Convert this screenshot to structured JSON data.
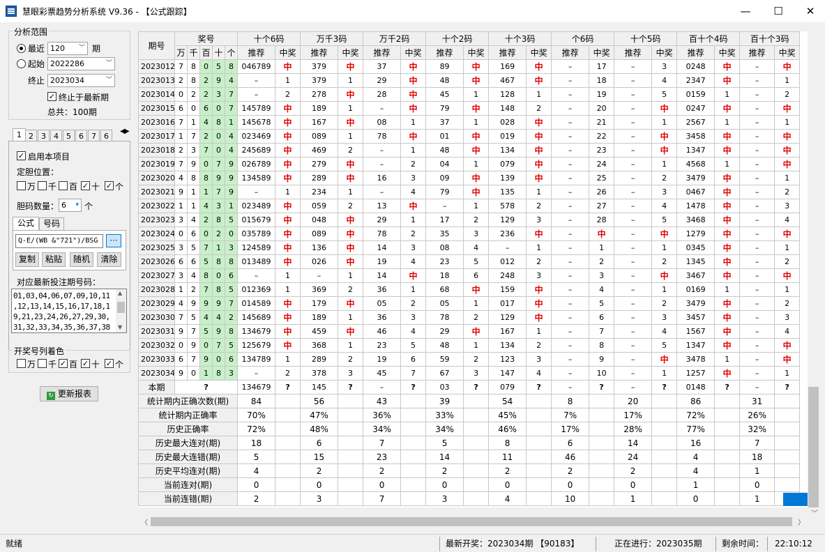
{
  "window": {
    "title": "慧眼彩票趋势分析系统 V9.36 - 【公式跟踪】",
    "minimize": "—",
    "maximize": "☐",
    "close": "✕"
  },
  "left": {
    "range_title": "分析范围",
    "recent_label": "最近",
    "recent_value": "120",
    "period_suffix": "期",
    "start_label": "起始",
    "start_value": "2022286",
    "end_label": "终止",
    "end_value": "2023034",
    "end_latest_label": "终止于最新期",
    "total_label": "总共：100期",
    "tabs": [
      "1",
      "2",
      "3",
      "4",
      "5",
      "6",
      "7",
      "6"
    ],
    "enable_label": "启用本项目",
    "pos_label": "定胆位置：",
    "positions": [
      {
        "label": "万",
        "checked": false
      },
      {
        "label": "千",
        "checked": false
      },
      {
        "label": "百",
        "checked": false
      },
      {
        "label": "十",
        "checked": true
      },
      {
        "label": "个",
        "checked": true
      }
    ],
    "count_label": "胆码数量：",
    "count_value": "6",
    "count_unit": "个",
    "sub_tabs": [
      "公式",
      "号码"
    ],
    "formula": "Q-E/(WB &\"721\")/BSG",
    "formula_btn": "···",
    "buttons": [
      "复制",
      "粘贴",
      "随机",
      "清除"
    ],
    "numbers_label": "对应最新投注期号码：",
    "numbers_lines": [
      "01,03,04,06,07,09,10,11",
      ",12,13,14,15,16,17,18,1",
      "9,21,23,24,26,27,29,30,",
      "31,32,33,34,35,36,37,38"
    ],
    "color_title": "开奖号列着色",
    "color_positions": [
      {
        "label": "万",
        "checked": false
      },
      {
        "label": "千",
        "checked": false
      },
      {
        "label": "百",
        "checked": true
      },
      {
        "label": "十",
        "checked": true
      },
      {
        "label": "个",
        "checked": true
      }
    ],
    "update_btn": "更新报表"
  },
  "table": {
    "period_header": "期号",
    "draw_header": "奖号",
    "digit_headers": [
      "万",
      "千",
      "百",
      "十",
      "个"
    ],
    "groups": [
      "十个6码",
      "万千3码",
      "万千2码",
      "十个2码",
      "十个3码",
      "个6码",
      "十个5码",
      "百十个4码",
      "百十个3码"
    ],
    "sub_headers": [
      "推荐",
      "中奖"
    ],
    "rows": [
      {
        "p": "2023012",
        "d": [
          "7",
          "8",
          "0",
          "5",
          "8"
        ],
        "c": [
          "046789",
          "中",
          "379",
          "中",
          "37",
          "中",
          "89",
          "中",
          "169",
          "中",
          "–",
          "17",
          "–",
          "3",
          "0248",
          "中",
          "–",
          "中"
        ]
      },
      {
        "p": "2023013",
        "d": [
          "2",
          "8",
          "2",
          "9",
          "4"
        ],
        "c": [
          "–",
          "1",
          "379",
          "1",
          "29",
          "中",
          "48",
          "中",
          "467",
          "中",
          "–",
          "18",
          "–",
          "4",
          "2347",
          "中",
          "–",
          "1"
        ]
      },
      {
        "p": "2023014",
        "d": [
          "0",
          "2",
          "2",
          "3",
          "7"
        ],
        "c": [
          "–",
          "2",
          "278",
          "中",
          "28",
          "中",
          "45",
          "1",
          "128",
          "1",
          "–",
          "19",
          "–",
          "5",
          "0159",
          "1",
          "–",
          "2"
        ]
      },
      {
        "p": "2023015",
        "d": [
          "6",
          "0",
          "6",
          "0",
          "7"
        ],
        "c": [
          "145789",
          "中",
          "189",
          "1",
          "–",
          "中",
          "79",
          "中",
          "148",
          "2",
          "–",
          "20",
          "–",
          "中",
          "0247",
          "中",
          "–",
          "中"
        ]
      },
      {
        "p": "2023016",
        "d": [
          "7",
          "1",
          "4",
          "8",
          "1"
        ],
        "c": [
          "145678",
          "中",
          "167",
          "中",
          "08",
          "1",
          "37",
          "1",
          "028",
          "中",
          "–",
          "21",
          "–",
          "1",
          "2567",
          "1",
          "–",
          "1"
        ]
      },
      {
        "p": "2023017",
        "d": [
          "1",
          "7",
          "2",
          "0",
          "4"
        ],
        "c": [
          "023469",
          "中",
          "089",
          "1",
          "78",
          "中",
          "01",
          "中",
          "019",
          "中",
          "–",
          "22",
          "–",
          "中",
          "3458",
          "中",
          "–",
          "中"
        ]
      },
      {
        "p": "2023018",
        "d": [
          "2",
          "3",
          "7",
          "0",
          "4"
        ],
        "c": [
          "245689",
          "中",
          "469",
          "2",
          "–",
          "1",
          "48",
          "中",
          "134",
          "中",
          "–",
          "23",
          "–",
          "中",
          "1347",
          "中",
          "–",
          "中"
        ]
      },
      {
        "p": "2023019",
        "d": [
          "7",
          "9",
          "0",
          "7",
          "9"
        ],
        "c": [
          "026789",
          "中",
          "279",
          "中",
          "–",
          "2",
          "04",
          "1",
          "079",
          "中",
          "–",
          "24",
          "–",
          "1",
          "4568",
          "1",
          "–",
          "中"
        ]
      },
      {
        "p": "2023020",
        "d": [
          "4",
          "8",
          "8",
          "9",
          "9"
        ],
        "c": [
          "134589",
          "中",
          "289",
          "中",
          "16",
          "3",
          "09",
          "中",
          "139",
          "中",
          "–",
          "25",
          "–",
          "2",
          "3479",
          "中",
          "–",
          "1"
        ]
      },
      {
        "p": "2023021",
        "d": [
          "9",
          "1",
          "1",
          "7",
          "9"
        ],
        "c": [
          "–",
          "1",
          "234",
          "1",
          "–",
          "4",
          "79",
          "中",
          "135",
          "1",
          "–",
          "26",
          "–",
          "3",
          "0467",
          "中",
          "–",
          "2"
        ]
      },
      {
        "p": "2023022",
        "d": [
          "1",
          "1",
          "4",
          "3",
          "1"
        ],
        "c": [
          "023489",
          "中",
          "059",
          "2",
          "13",
          "中",
          "–",
          "1",
          "578",
          "2",
          "–",
          "27",
          "–",
          "4",
          "1478",
          "中",
          "–",
          "3"
        ]
      },
      {
        "p": "2023023",
        "d": [
          "3",
          "4",
          "2",
          "8",
          "5"
        ],
        "c": [
          "015679",
          "中",
          "048",
          "中",
          "29",
          "1",
          "17",
          "2",
          "129",
          "3",
          "–",
          "28",
          "–",
          "5",
          "3468",
          "中",
          "–",
          "4"
        ]
      },
      {
        "p": "2023024",
        "d": [
          "0",
          "6",
          "0",
          "2",
          "0"
        ],
        "c": [
          "035789",
          "中",
          "089",
          "中",
          "78",
          "2",
          "35",
          "3",
          "236",
          "中",
          "–",
          "中",
          "–",
          "中",
          "1279",
          "中",
          "–",
          "中"
        ]
      },
      {
        "p": "2023025",
        "d": [
          "3",
          "5",
          "7",
          "1",
          "3"
        ],
        "c": [
          "124589",
          "中",
          "136",
          "中",
          "14",
          "3",
          "08",
          "4",
          "–",
          "1",
          "–",
          "1",
          "–",
          "1",
          "0345",
          "中",
          "–",
          "1"
        ]
      },
      {
        "p": "2023026",
        "d": [
          "6",
          "6",
          "5",
          "8",
          "8"
        ],
        "c": [
          "013489",
          "中",
          "026",
          "中",
          "19",
          "4",
          "23",
          "5",
          "012",
          "2",
          "–",
          "2",
          "–",
          "2",
          "1345",
          "中",
          "–",
          "2"
        ]
      },
      {
        "p": "2023027",
        "d": [
          "3",
          "4",
          "8",
          "0",
          "6"
        ],
        "c": [
          "–",
          "1",
          "–",
          "1",
          "14",
          "中",
          "18",
          "6",
          "248",
          "3",
          "–",
          "3",
          "–",
          "中",
          "3467",
          "中",
          "–",
          "中"
        ]
      },
      {
        "p": "2023028",
        "d": [
          "1",
          "2",
          "7",
          "8",
          "5"
        ],
        "c": [
          "012369",
          "1",
          "369",
          "2",
          "36",
          "1",
          "68",
          "中",
          "159",
          "中",
          "–",
          "4",
          "–",
          "1",
          "0169",
          "1",
          "–",
          "1"
        ]
      },
      {
        "p": "2023029",
        "d": [
          "4",
          "9",
          "9",
          "9",
          "7"
        ],
        "c": [
          "014589",
          "中",
          "179",
          "中",
          "05",
          "2",
          "05",
          "1",
          "017",
          "中",
          "–",
          "5",
          "–",
          "2",
          "3479",
          "中",
          "–",
          "2"
        ]
      },
      {
        "p": "2023030",
        "d": [
          "7",
          "5",
          "4",
          "4",
          "2"
        ],
        "c": [
          "145689",
          "中",
          "189",
          "1",
          "36",
          "3",
          "78",
          "2",
          "129",
          "中",
          "–",
          "6",
          "–",
          "3",
          "3457",
          "中",
          "–",
          "3"
        ]
      },
      {
        "p": "2023031",
        "d": [
          "9",
          "7",
          "5",
          "9",
          "8"
        ],
        "c": [
          "134679",
          "中",
          "459",
          "中",
          "46",
          "4",
          "29",
          "中",
          "167",
          "1",
          "–",
          "7",
          "–",
          "4",
          "1567",
          "中",
          "–",
          "4"
        ]
      },
      {
        "p": "2023032",
        "d": [
          "0",
          "9",
          "0",
          "7",
          "5"
        ],
        "c": [
          "125679",
          "中",
          "368",
          "1",
          "23",
          "5",
          "48",
          "1",
          "134",
          "2",
          "–",
          "8",
          "–",
          "5",
          "1347",
          "中",
          "–",
          "中"
        ]
      },
      {
        "p": "2023033",
        "d": [
          "6",
          "7",
          "9",
          "0",
          "6"
        ],
        "c": [
          "134789",
          "1",
          "289",
          "2",
          "19",
          "6",
          "59",
          "2",
          "123",
          "3",
          "–",
          "9",
          "–",
          "中",
          "3478",
          "1",
          "–",
          "中"
        ]
      },
      {
        "p": "2023034",
        "d": [
          "9",
          "0",
          "1",
          "8",
          "3"
        ],
        "c": [
          "–",
          "2",
          "378",
          "3",
          "45",
          "7",
          "67",
          "3",
          "147",
          "4",
          "–",
          "10",
          "–",
          "1",
          "1257",
          "中",
          "–",
          "1"
        ]
      }
    ],
    "current": {
      "label": "本期",
      "draw": "?",
      "c": [
        "134679",
        "?",
        "145",
        "?",
        "–",
        "?",
        "03",
        "?",
        "079",
        "?",
        "–",
        "?",
        "–",
        "?",
        "0148",
        "?",
        "–",
        "?"
      ]
    },
    "stats": [
      {
        "label": "统计期内正确次数(期)",
        "v": [
          "84",
          "56",
          "43",
          "39",
          "54",
          "8",
          "20",
          "86",
          "31"
        ]
      },
      {
        "label": "统计期内正确率",
        "v": [
          "70%",
          "47%",
          "36%",
          "33%",
          "45%",
          "7%",
          "17%",
          "72%",
          "26%"
        ]
      },
      {
        "label": "历史正确率",
        "v": [
          "72%",
          "48%",
          "34%",
          "34%",
          "46%",
          "17%",
          "28%",
          "77%",
          "32%"
        ]
      },
      {
        "label": "历史最大连对(期)",
        "v": [
          "18",
          "6",
          "7",
          "5",
          "8",
          "6",
          "14",
          "16",
          "7"
        ]
      },
      {
        "label": "历史最大连错(期)",
        "v": [
          "5",
          "15",
          "23",
          "14",
          "11",
          "46",
          "24",
          "4",
          "18"
        ]
      },
      {
        "label": "历史平均连对(期)",
        "v": [
          "4",
          "2",
          "2",
          "2",
          "2",
          "2",
          "2",
          "4",
          "1"
        ]
      },
      {
        "label": "当前连对(期)",
        "v": [
          "0",
          "0",
          "0",
          "0",
          "0",
          "0",
          "0",
          "1",
          "0"
        ]
      },
      {
        "label": "当前连错(期)",
        "v": [
          "2",
          "3",
          "7",
          "3",
          "4",
          "10",
          "1",
          "0",
          "1"
        ]
      }
    ]
  },
  "status": {
    "ready": "就绪",
    "latest": "最新开奖：2023034期 【90183】",
    "running": "正在进行：2023035期",
    "remain": "剩余时间：",
    "clock": "22:10:12"
  }
}
